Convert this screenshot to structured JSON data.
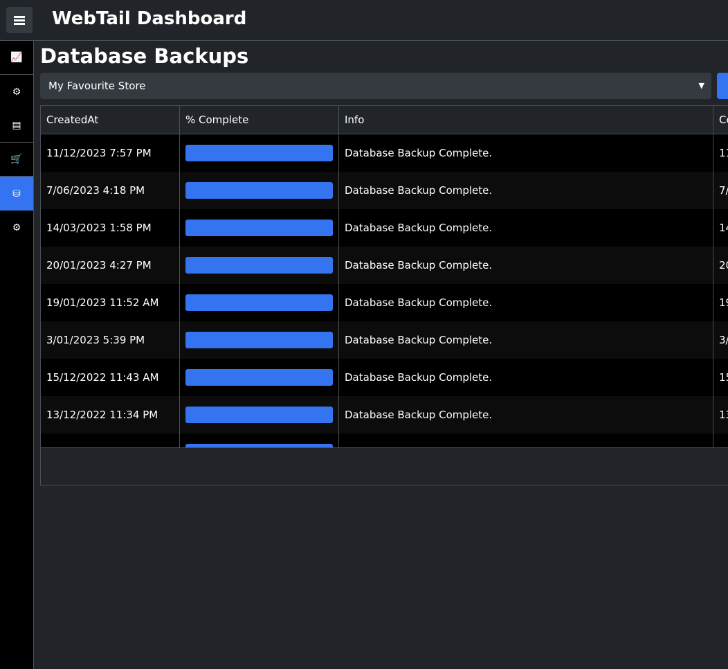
{
  "header": {
    "title": "WebTail Dashboard",
    "menu_icon": "hamburger-icon"
  },
  "sidebar": {
    "items": [
      {
        "name": "chart",
        "icon": "📈"
      },
      {
        "name": "settings",
        "icon": "⚙"
      },
      {
        "name": "reports",
        "icon": "▤"
      },
      {
        "name": "cart",
        "icon": "🛒"
      },
      {
        "name": "database",
        "icon": "⛁",
        "active": true
      },
      {
        "name": "advanced-settings",
        "icon": "⚙"
      }
    ]
  },
  "page": {
    "title": "Database Backups",
    "store_select": "My Favourite Store"
  },
  "table": {
    "columns": [
      "CreatedAt",
      "% Complete",
      "Info",
      "Co"
    ],
    "rows": [
      {
        "created": "11/12/2023 7:57 PM",
        "percent": 100,
        "info": "Database Backup Complete.",
        "completed": "11"
      },
      {
        "created": "7/06/2023 4:18 PM",
        "percent": 100,
        "info": "Database Backup Complete.",
        "completed": "7/"
      },
      {
        "created": "14/03/2023 1:58 PM",
        "percent": 100,
        "info": "Database Backup Complete.",
        "completed": "14"
      },
      {
        "created": "20/01/2023 4:27 PM",
        "percent": 100,
        "info": "Database Backup Complete.",
        "completed": "20"
      },
      {
        "created": "19/01/2023 11:52 AM",
        "percent": 100,
        "info": "Database Backup Complete.",
        "completed": "19"
      },
      {
        "created": "3/01/2023 5:39 PM",
        "percent": 100,
        "info": "Database Backup Complete.",
        "completed": "3/"
      },
      {
        "created": "15/12/2022 11:43 AM",
        "percent": 100,
        "info": "Database Backup Complete.",
        "completed": "15"
      },
      {
        "created": "13/12/2022 11:34 PM",
        "percent": 100,
        "info": "Database Backup Complete.",
        "completed": "13"
      },
      {
        "created": "",
        "percent": 100,
        "info": "",
        "completed": ""
      }
    ]
  },
  "colors": {
    "accent": "#3574f0",
    "background": "#212529"
  }
}
